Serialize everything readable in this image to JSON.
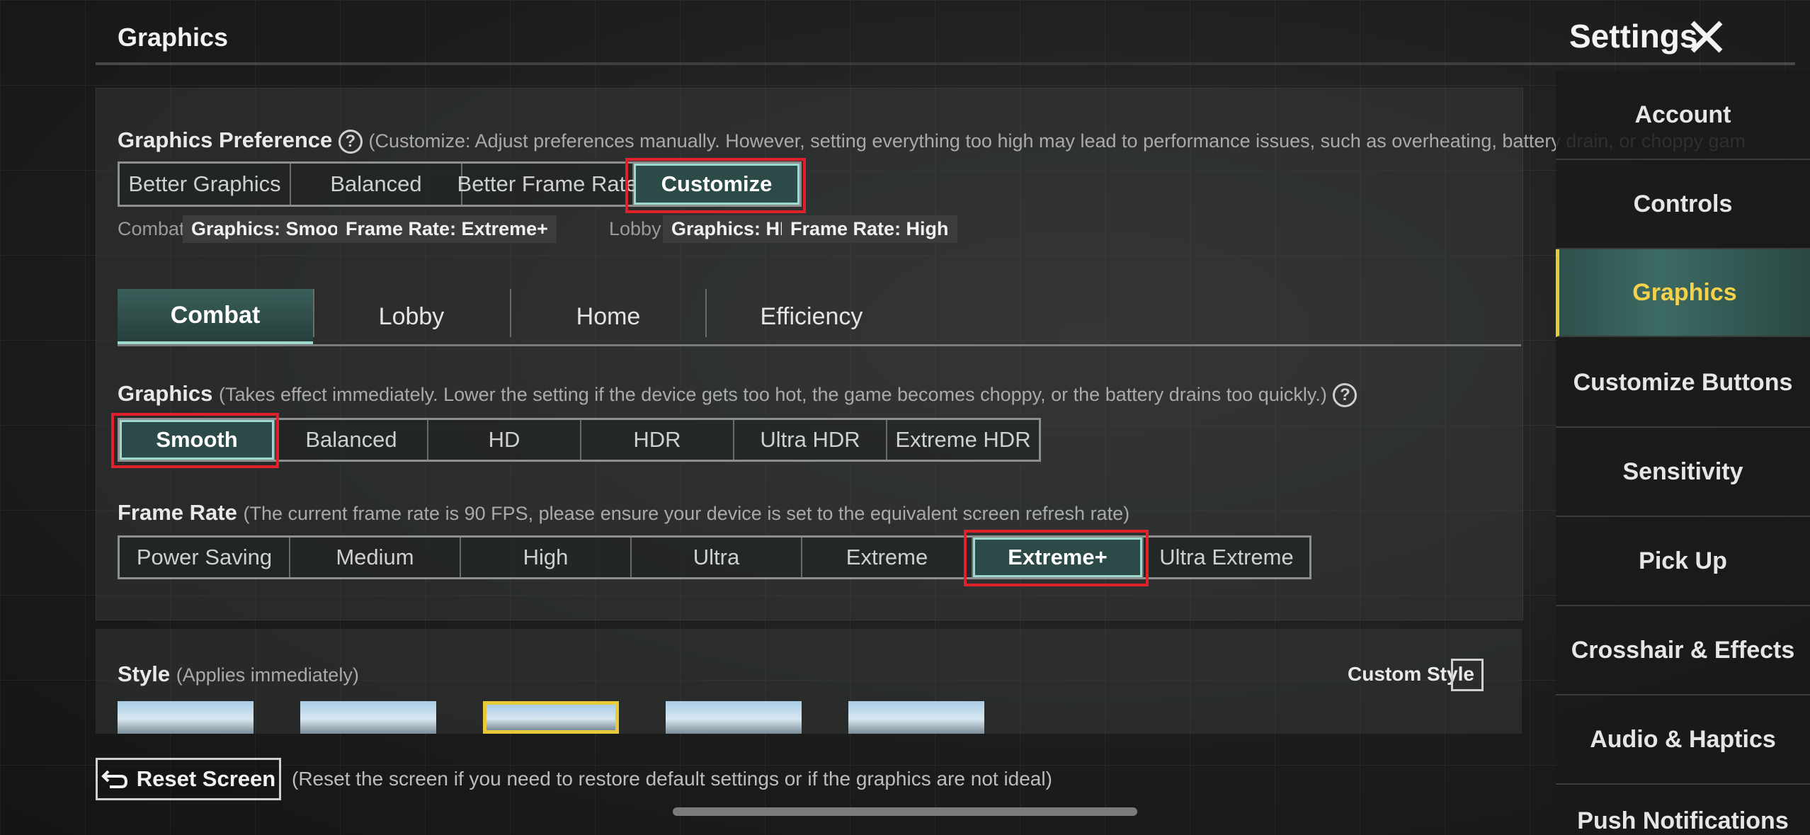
{
  "header": {
    "page_title": "Graphics",
    "settings_title": "Settings"
  },
  "preference": {
    "label": "Graphics Preference",
    "hint": "(Customize: Adjust preferences manually. However, setting everything too high may lead to performance issues, such as overheating, battery drain, or choppy gam",
    "options": [
      "Better Graphics",
      "Balanced",
      "Better Frame Rate",
      "Customize"
    ],
    "selected": "Customize",
    "combat_label": "Combat",
    "combat_graphics": "Graphics: Smooth",
    "combat_framerate": "Frame Rate: Extreme+",
    "lobby_label": "Lobby",
    "lobby_graphics": "Graphics: HD",
    "lobby_framerate": "Frame Rate: High"
  },
  "tabs": [
    "Combat",
    "Lobby",
    "Home",
    "Efficiency"
  ],
  "active_tab": "Combat",
  "graphics": {
    "label": "Graphics",
    "hint": "(Takes effect immediately. Lower the setting if the device gets too hot, the game becomes choppy, or the battery drains too quickly.)",
    "options": [
      "Smooth",
      "Balanced",
      "HD",
      "HDR",
      "Ultra HDR",
      "Extreme HDR"
    ],
    "selected": "Smooth"
  },
  "frame_rate": {
    "label": "Frame Rate",
    "hint": "(The current frame rate is 90 FPS, please ensure your device is set to the equivalent screen refresh rate)",
    "options": [
      "Power Saving",
      "Medium",
      "High",
      "Ultra",
      "Extreme",
      "Extreme+",
      "Ultra Extreme"
    ],
    "selected": "Extreme+"
  },
  "style": {
    "label": "Style",
    "hint": "(Applies immediately)",
    "custom_label": "Custom Style",
    "selected_index": 2
  },
  "footer": {
    "reset_label": "Reset Screen",
    "reset_hint": "(Reset the screen if you need to restore default settings or if the graphics are not ideal)"
  },
  "sidebar": {
    "items": [
      "Account",
      "Controls",
      "Graphics",
      "Customize Buttons",
      "Sensitivity",
      "Pick Up",
      "Crosshair & Effects",
      "Audio & Haptics",
      "Push Notifications"
    ],
    "active": "Graphics"
  },
  "colors": {
    "accent_selected": "#2c4a47",
    "highlight_outline": "#e0202a",
    "sidebar_active_text": "#f6d24a"
  }
}
